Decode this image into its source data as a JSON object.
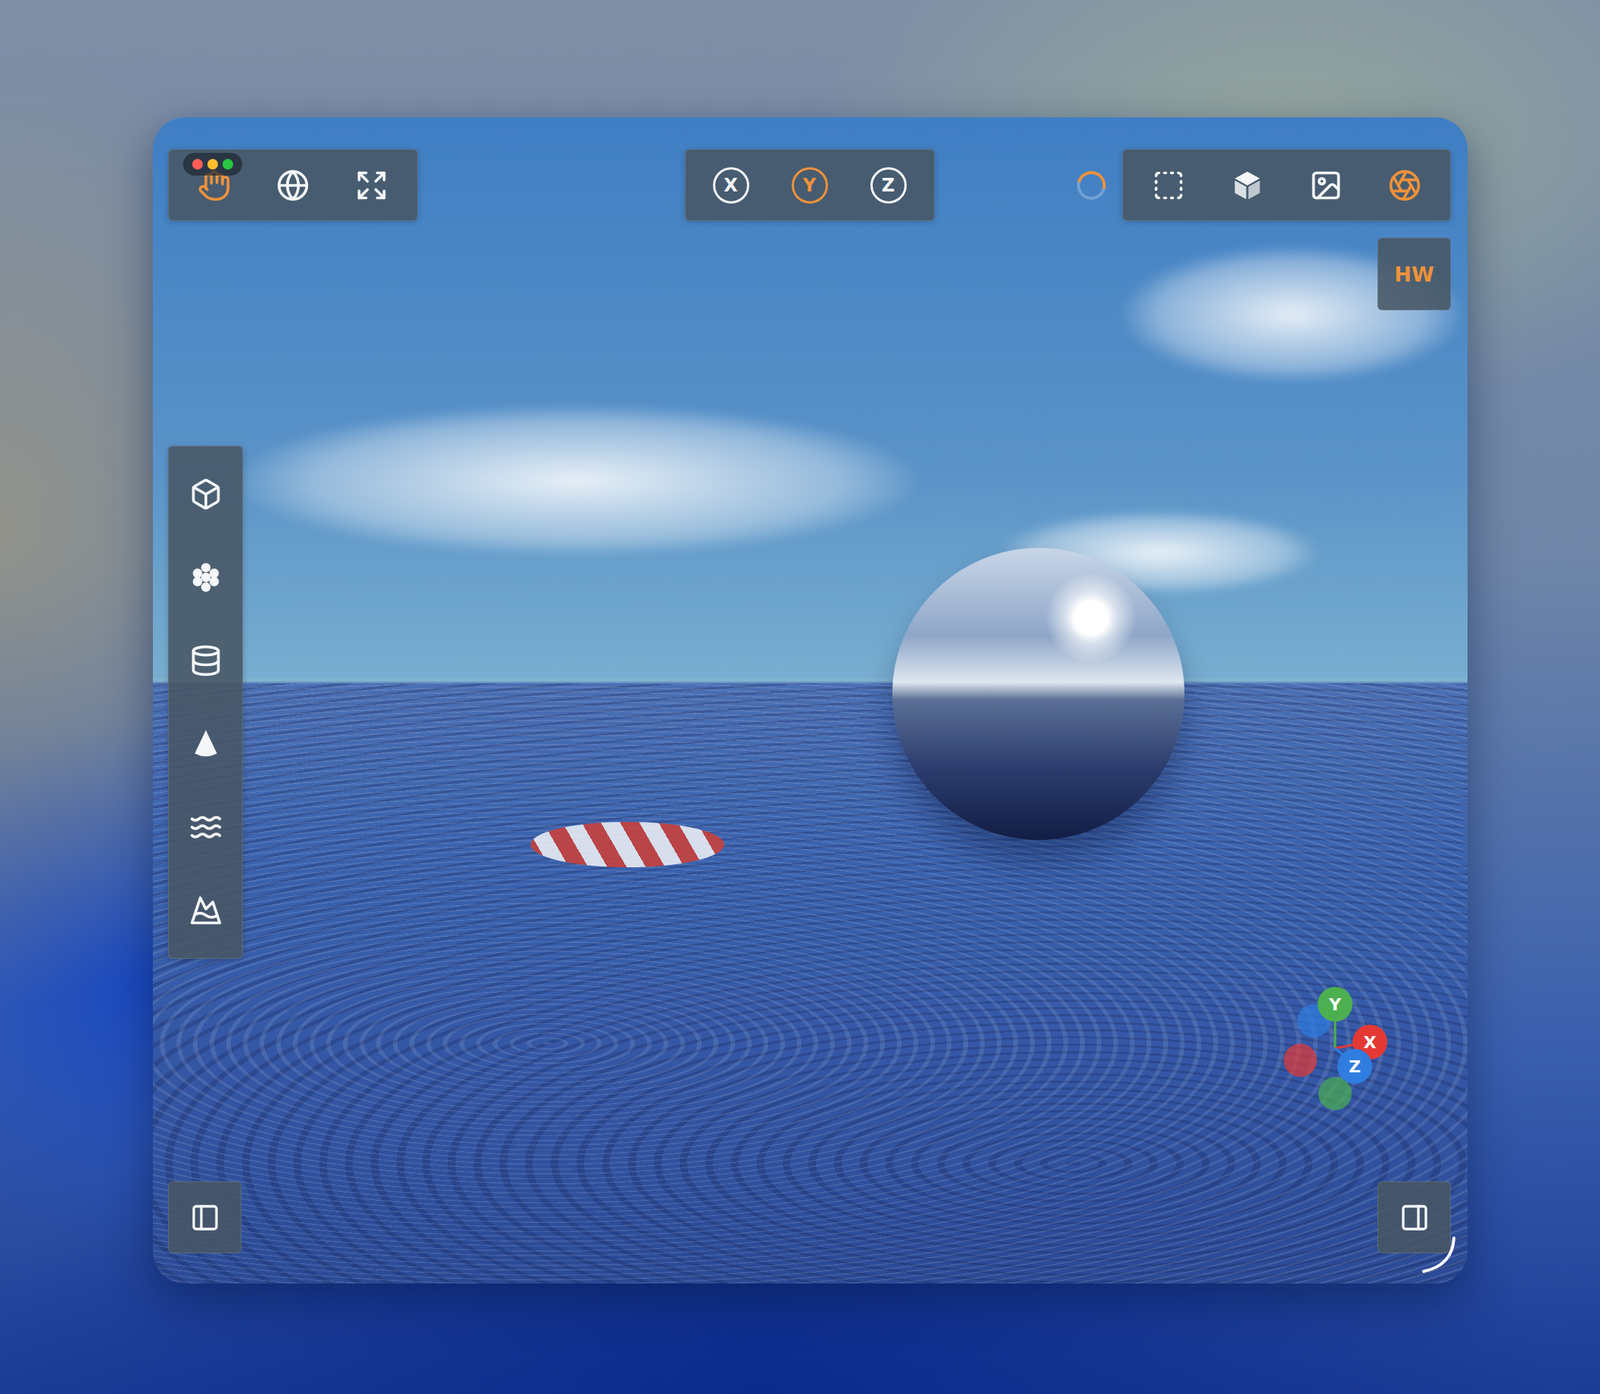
{
  "navigation_tools": [
    {
      "selected": true
    },
    {
      "selected": false
    },
    {
      "selected": false
    }
  ],
  "axis_buttons": [
    {
      "label": "X",
      "selected": false
    },
    {
      "label": "Y",
      "selected": true
    },
    {
      "label": "Z",
      "selected": false
    }
  ],
  "view_modes": [
    {
      "selected": false
    },
    {
      "selected": false
    },
    {
      "selected": false
    },
    {
      "selected": true
    }
  ],
  "hw_button": {
    "label": "HW",
    "selected": true
  },
  "gizmo": {
    "axes": [
      {
        "label": "Y",
        "color": "#4caf50"
      },
      {
        "label": "X",
        "color": "#e53935"
      },
      {
        "label": "Z",
        "color": "#2f7de1"
      }
    ]
  }
}
